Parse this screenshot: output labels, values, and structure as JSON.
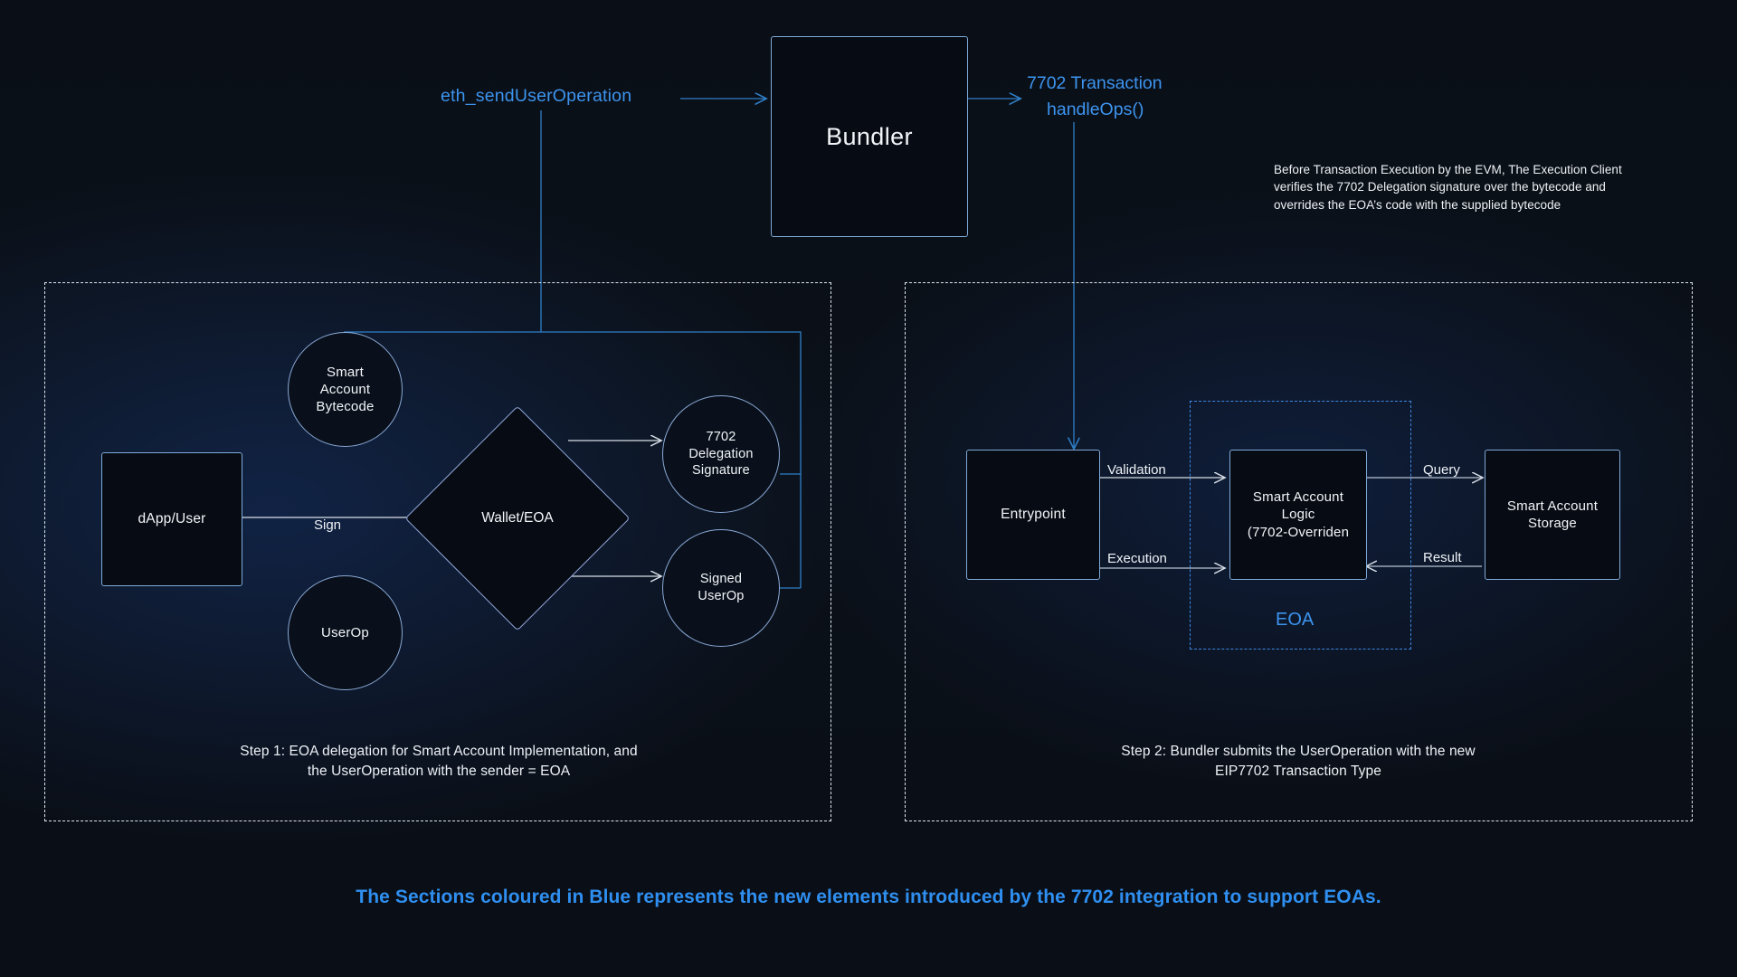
{
  "diagram": {
    "title_blue_1": "eth_sendUserOperation",
    "bundler": "Bundler",
    "tx_line1": "7702 Transaction",
    "tx_line2": "handleOps()",
    "note": "Before Transaction Execution by the EVM, The Execution Client verifies the 7702 Delegation signature over the bytecode and overrides the EOA’s code with the supplied bytecode",
    "footer": "The Sections coloured in Blue represents the new elements introduced by the 7702 integration to support EOAs."
  },
  "step1": {
    "caption_line1": "Step 1: EOA delegation for Smart Account Implementation, and",
    "caption_line2": "the UserOperation with the sender = EOA",
    "nodes": {
      "dapp_user": "dApp/User",
      "smart_account_bytecode": "Smart\nAccount\nBytecode",
      "userop": "UserOp",
      "wallet_eoa": "Wallet/EOA",
      "delegation_signature": "7702\nDelegation\nSignature",
      "signed_userop": "Signed\nUserOp"
    },
    "edges": {
      "sign": "Sign"
    }
  },
  "step2": {
    "caption_line1": "Step 2: Bundler submits the UserOperation with the new",
    "caption_line2": "EIP7702 Transaction Type",
    "nodes": {
      "entrypoint": "Entrypoint",
      "smart_account_logic": "Smart Account\nLogic\n(7702-Overriden",
      "smart_account_storage": "Smart Account\nStorage"
    },
    "eoa_label": "EOA",
    "edges": {
      "validation": "Validation",
      "execution": "Execution",
      "query": "Query",
      "result": "Result"
    }
  },
  "colors": {
    "background": "#0b1018",
    "accent_blue": "#3d94ef",
    "node_border": "#7fa9d8",
    "node_fill": "#070c14",
    "panel_dash": "#dfe6ee",
    "eoa_dash": "#3d86e0",
    "arrow": "#d8dfe8"
  }
}
